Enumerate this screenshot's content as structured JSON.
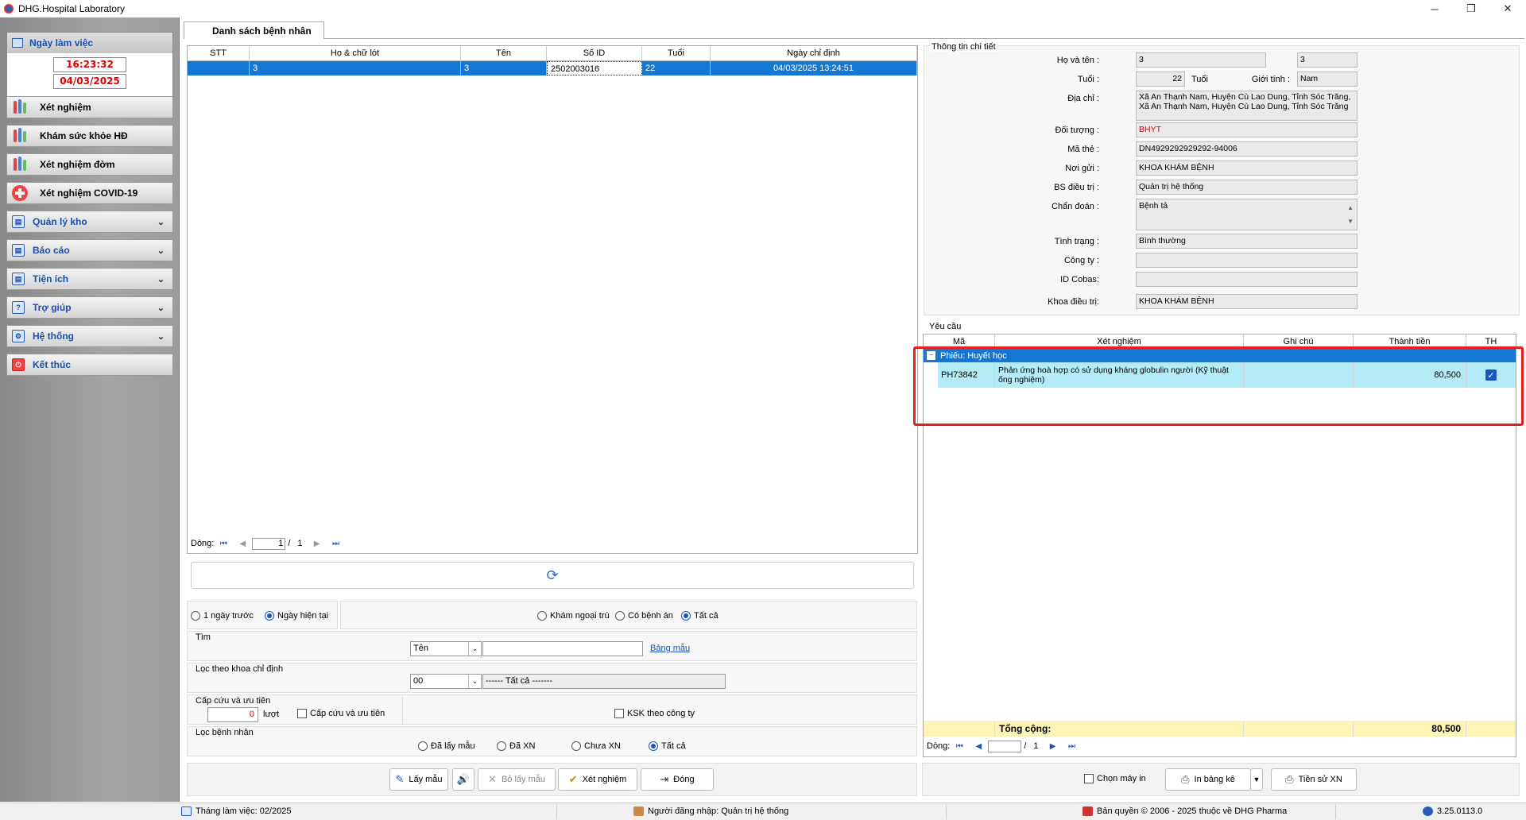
{
  "window": {
    "title": "DHG.Hospital Laboratory",
    "minimize": "─",
    "maximize": "❐",
    "close": "✕"
  },
  "nav": {
    "workday": {
      "label": "Ngày làm việc",
      "time": "16:23:32",
      "date": "04/03/2025"
    },
    "items": [
      {
        "label": "Xét nghiệm"
      },
      {
        "label": "Khám sức khỏe HĐ"
      },
      {
        "label": "Xét nghiệm đờm"
      },
      {
        "label": "Xét nghiệm COVID-19"
      }
    ],
    "groups": [
      {
        "label": "Quản lý kho"
      },
      {
        "label": "Báo cáo"
      },
      {
        "label": "Tiện ích"
      },
      {
        "label": "Trợ giúp"
      },
      {
        "label": "Hệ thống"
      },
      {
        "label": "Kết thúc"
      }
    ]
  },
  "tab": {
    "label": "Danh sách bệnh nhân"
  },
  "patients": {
    "columns": [
      "STT",
      "Họ & chữ lót",
      "Tên",
      "Số ID",
      "Tuổi",
      "Ngày chỉ định"
    ],
    "rows": [
      {
        "stt": "3",
        "ho": "",
        "ten": "3",
        "so_id": "2502003016",
        "tuoi": "22",
        "ngay": "04/03/2025 13:24:51"
      }
    ],
    "pager": {
      "label": "Dòng:",
      "current": "1",
      "sep": "/",
      "total": "1"
    }
  },
  "filters": {
    "date": {
      "prev": "1 ngày trước",
      "today": "Ngày hiện tại"
    },
    "type": {
      "outpatient": "Khám ngoại trú",
      "record": "Có bệnh án",
      "all": "Tất cả"
    },
    "search": {
      "title": "Tìm",
      "field": "Tên",
      "value": "",
      "link": "Bảng mẫu"
    },
    "dept": {
      "title": "Lọc theo khoa chỉ định",
      "code": "00",
      "name": "------ Tất cả -------"
    },
    "emergency": {
      "title": "Cấp cứu và ưu tiên",
      "count": "0",
      "unit": "lượt",
      "checkbox": "Cấp cứu và ưu tiên",
      "ksk": "KSK theo công ty"
    },
    "patient_filter": {
      "title": "Lọc bệnh nhân",
      "sampled": "Đã lấy mẫu",
      "tested": "Đã XN",
      "not_tested": "Chưa XN",
      "all": "Tất cả"
    }
  },
  "actions": {
    "take_sample": "Lấy mẫu",
    "cancel_sample": "Bỏ lấy mẫu",
    "test": "Xét nghiệm",
    "close": "Đóng"
  },
  "detail": {
    "title": "Thông tin chi tiết",
    "ho_ten_label": "Họ và tên :",
    "ho": "3",
    "ten": "3",
    "tuoi_label": "Tuổi :",
    "tuoi": "22",
    "tuoi_unit": "Tuổi",
    "gioi_tinh_label": "Giới tính :",
    "gioi_tinh": "Nam",
    "dia_chi_label": "Địa chỉ :",
    "dia_chi": "Xã An Thạnh Nam, Huyện Cù Lao Dung, Tỉnh Sóc Trăng, Xã An Thạnh Nam, Huyện Cù Lao Dung, Tỉnh Sóc Trăng",
    "doi_tuong_label": "Đối tượng :",
    "doi_tuong": "BHYT",
    "ma_the_label": "Mã thẻ :",
    "ma_the": "DN4929292929292-94006",
    "noi_gui_label": "Nơi gửi :",
    "noi_gui": "KHOA KHÁM BỆNH",
    "bs_label": "BS điều trị :",
    "bs": "Quản trị hệ thống",
    "chan_doan_label": "Chẩn đoán :",
    "chan_doan": "Bệnh tả",
    "tinh_trang_label": "Tình trạng :",
    "tinh_trang": "Bình thường",
    "cong_ty_label": "Công ty :",
    "cong_ty": "",
    "id_cobas_label": "ID Cobas:",
    "id_cobas": "",
    "khoa_label": "Khoa điều trị:",
    "khoa": "KHOA KHÁM BỆNH"
  },
  "requests": {
    "title": "Yêu cầu",
    "columns": [
      "Mã",
      "Xét nghiệm",
      "Ghi chú",
      "Thành tiền",
      "TH"
    ],
    "group_label": "Phiếu:  Huyết học",
    "rows": [
      {
        "ma": "PH73842",
        "xet_nghiem": "Phản ứng hoà hợp có sử dụng kháng globulin người (Kỹ thuật ống nghiệm)",
        "ghi_chu": "",
        "thanh_tien": "80,500",
        "checked": true
      }
    ],
    "total_label": "Tổng cộng:",
    "total": "80,500",
    "pager": {
      "label": "Dòng:",
      "current": "",
      "sep": "/",
      "total": "1"
    }
  },
  "right_actions": {
    "choose_machine": "Chọn máy in",
    "print": "In bảng kê",
    "history": "Tiền sử XN"
  },
  "status": {
    "month": "Tháng làm việc: 02/2025",
    "user": "Người đăng nhập: Quản trị hệ thống",
    "copyright": "Bản quyền © 2006 - 2025 thuộc về DHG Pharma",
    "version": "3.25.0113.0"
  },
  "colors": {
    "selection": "#1577d4",
    "highlight_row": "#b3ecf7",
    "total_bg": "#fff4b8",
    "annotation": "#e52020"
  }
}
